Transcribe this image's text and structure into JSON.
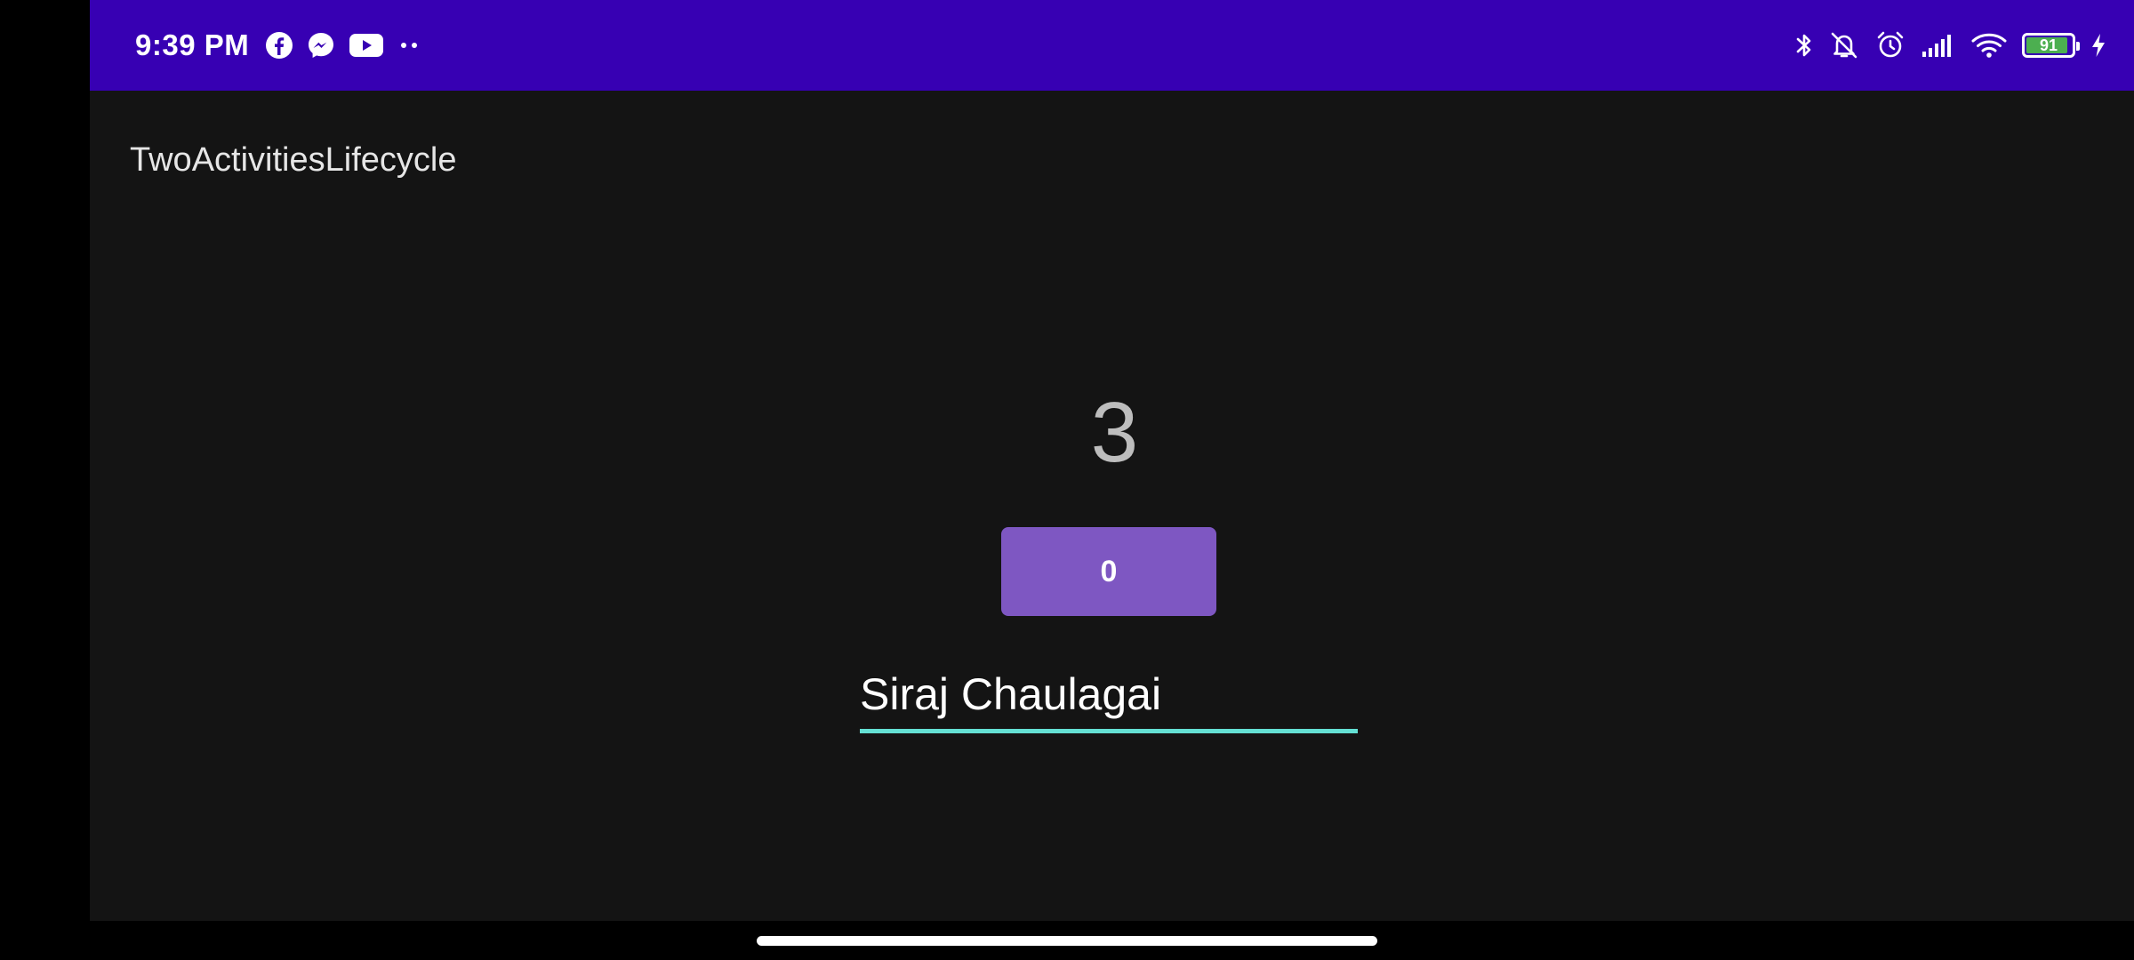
{
  "status_bar": {
    "time": "9:39 PM",
    "notification_icons": [
      "facebook-icon",
      "messenger-icon",
      "youtube-icon",
      "more-dots-icon"
    ],
    "system_icons": [
      "bluetooth-icon",
      "vibrate-off-icon",
      "alarm-icon",
      "cellular-signal-icon",
      "wifi-icon",
      "battery-icon",
      "charging-bolt-icon"
    ],
    "battery_level": "91",
    "battery_fraction": 0.91,
    "background_color": "#3700B3"
  },
  "app_bar": {
    "title": "TwoActivitiesLifecycle"
  },
  "main": {
    "counter_value": "3",
    "count_button_label": "0",
    "name_input_value": "Siraj Chaulagai"
  },
  "colors": {
    "background": "#141414",
    "button": "#7E57C2",
    "input_underline": "#64E0D4"
  }
}
